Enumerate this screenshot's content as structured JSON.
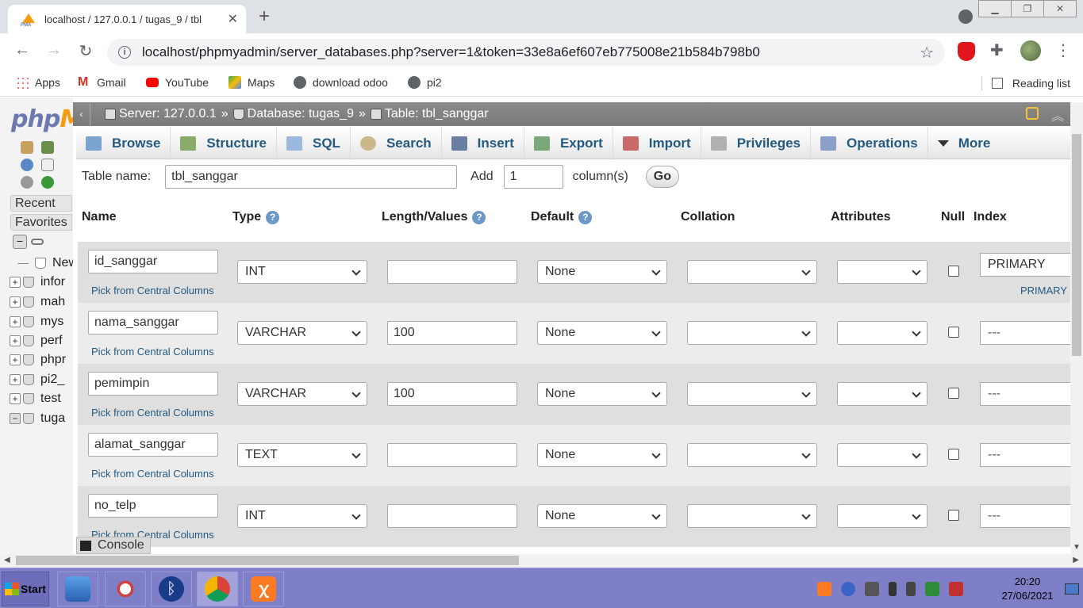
{
  "browser": {
    "tab_title": "localhost / 127.0.0.1 / tugas_9 / tbl",
    "url": "localhost/phpmyadmin/server_databases.php?server=1&token=33e8a6ef607eb775008e21b584b798b0",
    "bookmarks": [
      "Apps",
      "Gmail",
      "YouTube",
      "Maps",
      "download odoo",
      "pi2"
    ],
    "reading_list": "Reading list"
  },
  "nav": {
    "recent": "Recent",
    "favorites": "Favorites",
    "tree": [
      {
        "label": "New",
        "icon": "new-icon"
      },
      {
        "label": "infor",
        "icon": "plus-icon"
      },
      {
        "label": "mah",
        "icon": "plus-icon"
      },
      {
        "label": "mys",
        "icon": "plus-icon"
      },
      {
        "label": "perf",
        "icon": "plus-icon"
      },
      {
        "label": "phpr",
        "icon": "plus-icon"
      },
      {
        "label": "pi2_",
        "icon": "plus-icon"
      },
      {
        "label": "test",
        "icon": "plus-icon"
      },
      {
        "label": "tuga",
        "icon": "minus-icon"
      }
    ]
  },
  "breadcrumb": {
    "server": "Server: 127.0.0.1",
    "database": "Database: tugas_9",
    "table": "Table: tbl_sanggar",
    "sep": "»"
  },
  "tabs": [
    "Browse",
    "Structure",
    "SQL",
    "Search",
    "Insert",
    "Export",
    "Import",
    "Privileges",
    "Operations",
    "More"
  ],
  "form": {
    "table_name_label": "Table name:",
    "table_name_value": "tbl_sanggar",
    "add_label": "Add",
    "add_value": "1",
    "columns_label": "column(s)",
    "go_label": "Go"
  },
  "headers": {
    "name": "Name",
    "type": "Type",
    "length": "Length/Values",
    "default": "Default",
    "collation": "Collation",
    "attributes": "Attributes",
    "null": "Null",
    "index": "Index"
  },
  "pick_label": "Pick from Central Columns",
  "columns": [
    {
      "name": "id_sanggar",
      "type": "INT",
      "length": "",
      "default": "None",
      "index": "PRIMARY",
      "index_link": "PRIMARY"
    },
    {
      "name": "nama_sanggar",
      "type": "VARCHAR",
      "length": "100",
      "default": "None",
      "index": "---"
    },
    {
      "name": "pemimpin",
      "type": "VARCHAR",
      "length": "100",
      "default": "None",
      "index": "---"
    },
    {
      "name": "alamat_sanggar",
      "type": "TEXT",
      "length": "",
      "default": "None",
      "index": "---"
    },
    {
      "name": "no_telp",
      "type": "INT",
      "length": "",
      "default": "None",
      "index": "---"
    }
  ],
  "console_label": "Console",
  "taskbar": {
    "start": "Start",
    "time": "20:20",
    "date": "27/06/2021"
  }
}
